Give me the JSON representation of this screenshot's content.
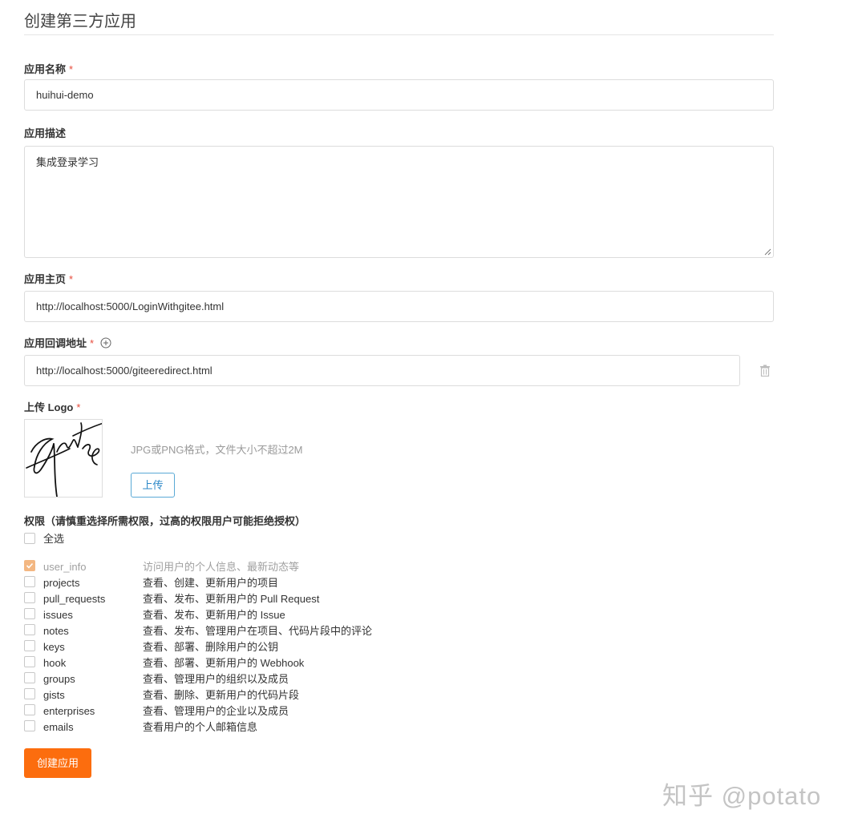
{
  "page": {
    "title": "创建第三方应用"
  },
  "form": {
    "name": {
      "label": "应用名称",
      "required_mark": "*",
      "value": "huihui-demo"
    },
    "description": {
      "label": "应用描述",
      "value": "集成登录学习"
    },
    "homepage": {
      "label": "应用主页",
      "required_mark": "*",
      "value": "http://localhost:5000/LoginWithgitee.html"
    },
    "callback": {
      "label": "应用回调地址",
      "required_mark": "*",
      "value": "http://localhost:5000/giteeredirect.html",
      "add_icon": "plus-circle-icon",
      "delete_icon": "trash-icon"
    },
    "logo": {
      "label": "上传 Logo",
      "required_mark": "*",
      "hint": "JPG或PNG格式，文件大小不超过2M",
      "upload_label": "上传"
    }
  },
  "permissions": {
    "title": "权限（请慎重选择所需权限，过高的权限用户可能拒绝授权）",
    "select_all": {
      "label": "全选",
      "checked": false
    },
    "scopes": [
      {
        "name": "user_info",
        "desc": "访问用户的个人信息、最新动态等",
        "checked": true,
        "disabled": true
      },
      {
        "name": "projects",
        "desc": "查看、创建、更新用户的项目",
        "checked": false
      },
      {
        "name": "pull_requests",
        "desc": "查看、发布、更新用户的 Pull Request",
        "checked": false
      },
      {
        "name": "issues",
        "desc": "查看、发布、更新用户的 Issue",
        "checked": false
      },
      {
        "name": "notes",
        "desc": "查看、发布、管理用户在项目、代码片段中的评论",
        "checked": false
      },
      {
        "name": "keys",
        "desc": "查看、部署、删除用户的公钥",
        "checked": false
      },
      {
        "name": "hook",
        "desc": "查看、部署、更新用户的 Webhook",
        "checked": false
      },
      {
        "name": "groups",
        "desc": "查看、管理用户的组织以及成员",
        "checked": false
      },
      {
        "name": "gists",
        "desc": "查看、删除、更新用户的代码片段",
        "checked": false
      },
      {
        "name": "enterprises",
        "desc": "查看、管理用户的企业以及成员",
        "checked": false
      },
      {
        "name": "emails",
        "desc": "查看用户的个人邮箱信息",
        "checked": false
      }
    ]
  },
  "submit": {
    "label": "创建应用"
  },
  "watermark": "知乎 @potato",
  "colors": {
    "accent": "#fc6d0e",
    "required": "#e74c3c",
    "upload_border": "#5aa9d6",
    "checked": "#f3b782"
  }
}
